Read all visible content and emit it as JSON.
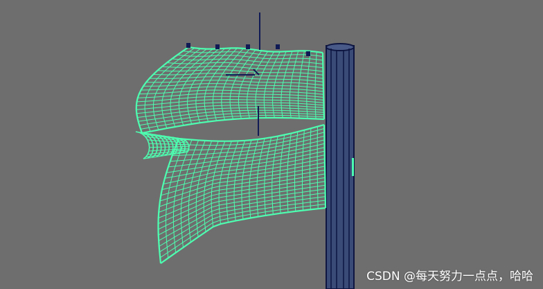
{
  "viewport": {
    "background": "#6e6e6e"
  },
  "cloth": {
    "wire_color": "#4dffb0",
    "rows": 22,
    "cols": 22
  },
  "pole": {
    "fill": "#3b4b78",
    "outline": "#0d1540",
    "line_color": "#0d1540"
  },
  "pivot": {
    "color": "#101a55"
  },
  "constraint_handles": {
    "color": "#101a55",
    "count": 5
  },
  "watermark": {
    "text": "CSDN @每天努力一点点，哈哈"
  }
}
